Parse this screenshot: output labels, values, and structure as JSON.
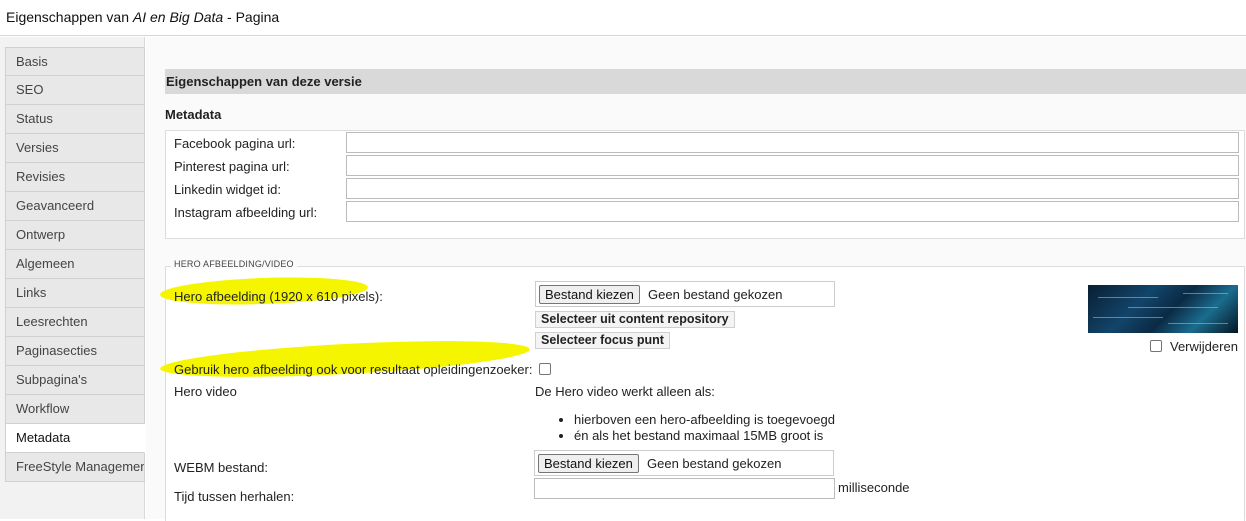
{
  "window": {
    "title_prefix": "Eigenschappen van ",
    "title_name": "AI en Big Data",
    "title_suffix": " - Pagina"
  },
  "tabs": [
    {
      "label": "Basis"
    },
    {
      "label": "SEO"
    },
    {
      "label": "Status"
    },
    {
      "label": "Versies"
    },
    {
      "label": "Revisies"
    },
    {
      "label": "Geavanceerd"
    },
    {
      "label": "Ontwerp"
    },
    {
      "label": "Algemeen"
    },
    {
      "label": "Links"
    },
    {
      "label": "Leesrechten"
    },
    {
      "label": "Paginasecties"
    },
    {
      "label": "Subpagina's"
    },
    {
      "label": "Workflow"
    },
    {
      "label": "Metadata"
    },
    {
      "label": "FreeStyle Management"
    }
  ],
  "active_tab": "Metadata",
  "section": {
    "header": "Eigenschappen van deze versie",
    "subtitle": "Metadata"
  },
  "metadata_fields": [
    {
      "label": "Facebook pagina url:",
      "value": ""
    },
    {
      "label": "Pinterest pagina url:",
      "value": ""
    },
    {
      "label": "Linkedin widget id:",
      "value": ""
    },
    {
      "label": "Instagram afbeelding url:",
      "value": ""
    }
  ],
  "hero": {
    "legend": "HERO AFBEELDING/VIDEO",
    "image_label": "Hero afbeelding (1920 x 610 pixels):",
    "file_button": "Bestand kiezen",
    "no_file": "Geen bestand gekozen",
    "select_repo_button": "Selecteer uit content repository",
    "select_focus_button": "Selecteer focus punt",
    "remove_label": "Verwijderen",
    "use_label": "Gebruik hero afbeelding ook voor resultaat opleidingenzoeker:",
    "video_label": "Hero video",
    "video_note": "De Hero video werkt alleen als:",
    "video_conditions": [
      "hierboven een hero-afbeelding is toegevoegd",
      "én als het bestand maximaal 15MB groot is"
    ],
    "webm_label": "WEBM bestand:",
    "webm_button": "Bestand kiezen",
    "webm_no_file": "Geen bestand gekozen",
    "repeat_label": "Tijd tussen herhalen:",
    "repeat_value": "",
    "repeat_unit": "milliseconde"
  },
  "colors": {
    "highlight": "#f5f500",
    "section_header_bg": "#d9d9d9",
    "sidebar_bg": "#f2f2f2"
  }
}
